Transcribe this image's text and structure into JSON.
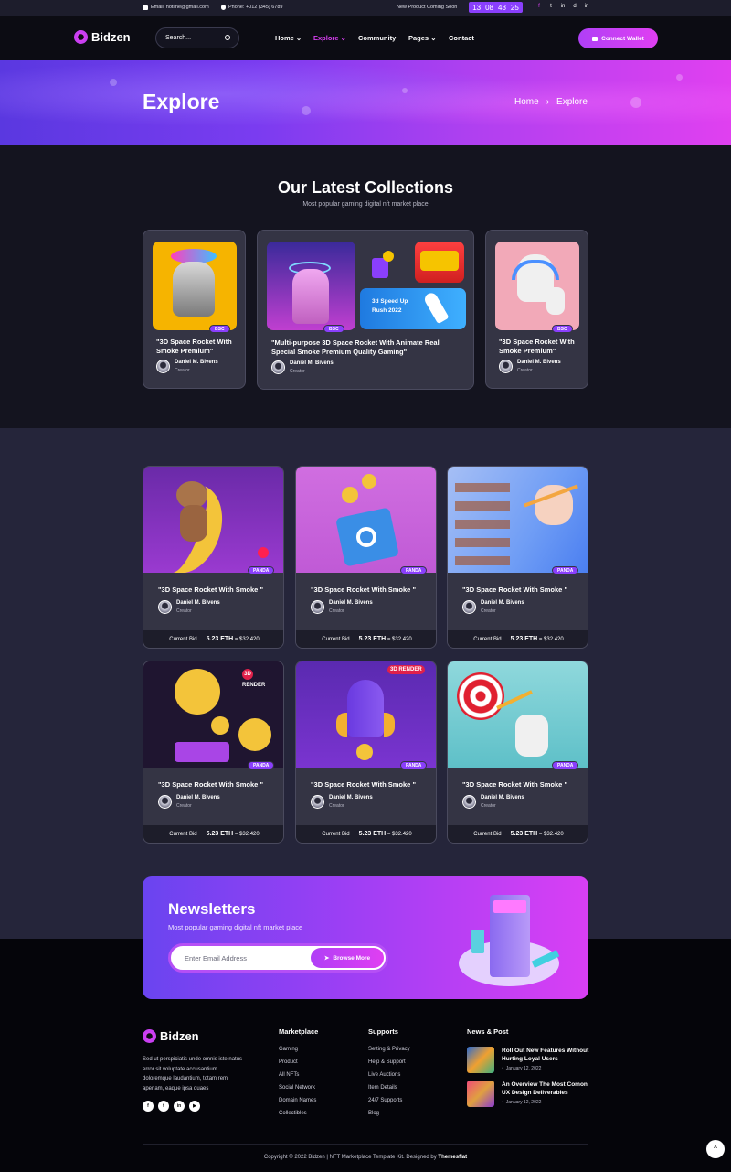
{
  "topbar": {
    "email": "Email: hotline@gmail.com",
    "phone": "Phone: +012 (345) 6789",
    "coming": "New Product Coming Soon",
    "timer": [
      "13",
      "08",
      "43",
      "25"
    ],
    "socials": [
      "f",
      "t",
      "in",
      "d",
      "in"
    ]
  },
  "header": {
    "brand": "Bidzen",
    "search_placeholder": "Search...",
    "nav": [
      {
        "label": "Home"
      },
      {
        "label": "Explore"
      },
      {
        "label": "Community"
      },
      {
        "label": "Pages"
      },
      {
        "label": "Contact"
      }
    ],
    "wallet_label": "Connect Wallet"
  },
  "hero": {
    "title": "Explore",
    "crumb_home": "Home",
    "crumb_sep": "›",
    "crumb_current": "Explore"
  },
  "collections": {
    "title": "Our Latest Collections",
    "subtitle": "Most popular gaming digital nft market place",
    "cards": [
      {
        "title": "\"3D Space Rocket With Smoke Premium\"",
        "badge": "BSC",
        "creator": "Daniel M. Bivens",
        "role": "Creator"
      },
      {
        "title": "\"Multi-purpose 3D Space Rocket With Animate Real Special Smoke Premium Quality Gaming\"",
        "badge": "BSC",
        "creator": "Daniel M. Bivens",
        "role": "Creator",
        "promo": "3d Speed Up Rush 2022"
      },
      {
        "title": "\"3D Space Rocket With Smoke Premium\"",
        "badge": "BSC",
        "creator": "Daniel M. Bivens",
        "role": "Creator"
      }
    ]
  },
  "grid": {
    "cards": [
      {
        "title": "\"3D Space Rocket With Smoke \"",
        "badge": "PANDA",
        "creator": "Daniel M. Bivens",
        "role": "Creator",
        "bid_label": "Current Bid",
        "eth": "5.23 ETH",
        "usd": "= $32.420"
      },
      {
        "title": "\"3D Space Rocket With Smoke \"",
        "badge": "PANDA",
        "creator": "Daniel M. Bivens",
        "role": "Creator",
        "bid_label": "Current Bid",
        "eth": "5.23 ETH",
        "usd": "= $32.420"
      },
      {
        "title": "\"3D Space Rocket With Smoke \"",
        "badge": "PANDA",
        "creator": "Daniel M. Bivens",
        "role": "Creator",
        "bid_label": "Current Bid",
        "eth": "5.23 ETH",
        "usd": "= $32.420"
      },
      {
        "title": "\"3D Space Rocket With Smoke \"",
        "badge": "PANDA",
        "creator": "Daniel M. Bivens",
        "role": "Creator",
        "bid_label": "Current Bid",
        "eth": "5.23 ETH",
        "usd": "= $32.420",
        "tag": "3D RENDER"
      },
      {
        "title": "\"3D Space Rocket With Smoke \"",
        "badge": "PANDA",
        "creator": "Daniel M. Bivens",
        "role": "Creator",
        "bid_label": "Current Bid",
        "eth": "5.23 ETH",
        "usd": "= $32.420",
        "tag": "3D RENDER"
      },
      {
        "title": "\"3D Space Rocket With Smoke \"",
        "badge": "PANDA",
        "creator": "Daniel M. Bivens",
        "role": "Creator",
        "bid_label": "Current Bid",
        "eth": "5.23 ETH",
        "usd": "= $32.420"
      }
    ]
  },
  "newsletter": {
    "title": "Newsletters",
    "subtitle": "Most popular gaming digital nft market place",
    "placeholder": "Enter Email Address",
    "button": "Browse More"
  },
  "footer": {
    "brand": "Bidzen",
    "text": "Sed ut perspiciatis unde omnis iste natus error sit voluptate accusantium doloremque laudantium, totam rem aperiam, eaque ipsa quaes",
    "socials": [
      "f",
      "t",
      "in",
      "▶"
    ],
    "marketplace_title": "Marketplace",
    "marketplace": [
      "Gaming",
      "Product",
      "All NFTs",
      "Social Network",
      "Domain Names",
      "Collectibles"
    ],
    "supports_title": "Supports",
    "supports": [
      "Setting & Privacy",
      "Help & Support",
      "Live Auctions",
      "Item Details",
      "24/7 Supports",
      "Blog"
    ],
    "news_title": "News & Post",
    "news": [
      {
        "title": "Roll Out New Features Without Hurting Loyal Users",
        "date": "January 12, 2022"
      },
      {
        "title": "An Overview The Most Comon UX Design Deliverables",
        "date": "January 12, 2022"
      }
    ],
    "copyright": "Copyright © 2022 Bidzen | NFT Marketplace Template Kit. Designed by",
    "designer": "Themesflat",
    "totop": "^"
  },
  "colors": {
    "accent": "#8a3ffc",
    "pink": "#e03ff2",
    "bg": "#14141f",
    "card": "#343444"
  }
}
